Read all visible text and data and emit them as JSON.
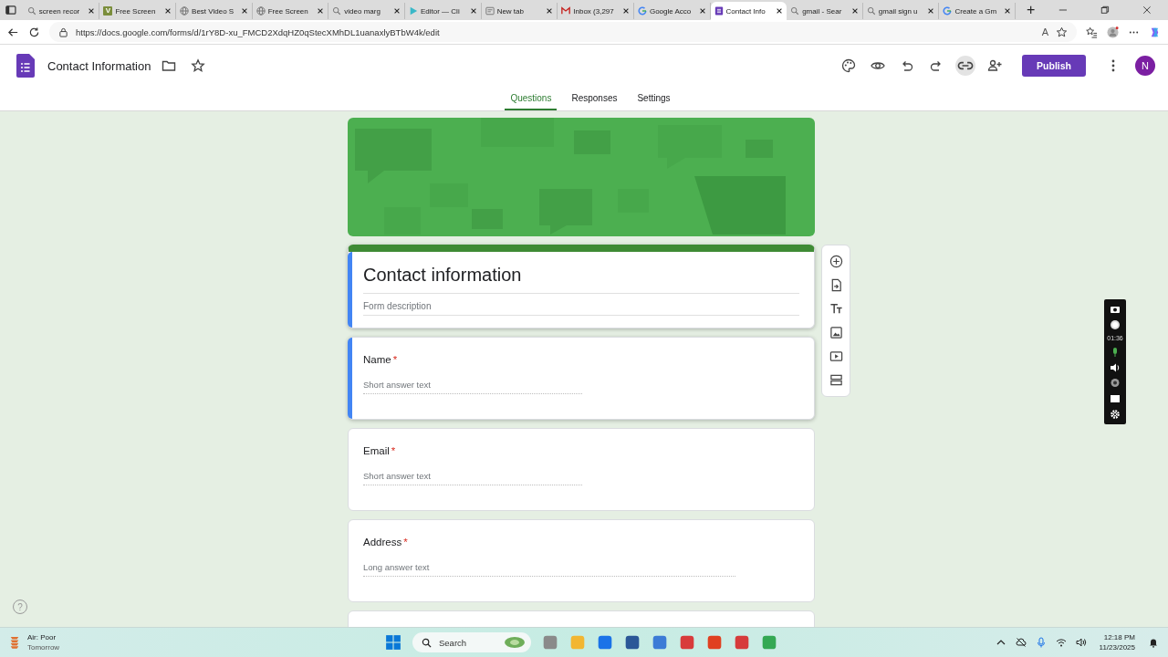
{
  "browser": {
    "tabs": [
      {
        "label": "screen recor",
        "kind": "search",
        "selected": false
      },
      {
        "label": "Free Screen",
        "kind": "letter",
        "selected": false
      },
      {
        "label": "Best Video S",
        "kind": "globe",
        "selected": false
      },
      {
        "label": "Free Screen",
        "kind": "globe",
        "selected": false
      },
      {
        "label": "video marg",
        "kind": "search",
        "selected": false
      },
      {
        "label": "Editor — Cli",
        "kind": "play",
        "selected": false
      },
      {
        "label": "New tab",
        "kind": "page",
        "selected": false
      },
      {
        "label": "Inbox (3,297",
        "kind": "mail",
        "selected": false
      },
      {
        "label": "Google Acco",
        "kind": "google",
        "selected": false
      },
      {
        "label": "Contact Info",
        "kind": "form",
        "selected": true
      },
      {
        "label": "gmail - Sear",
        "kind": "search",
        "selected": false
      },
      {
        "label": "gmail sign u",
        "kind": "search",
        "selected": false
      },
      {
        "label": "Create a Gm",
        "kind": "google",
        "selected": false
      }
    ],
    "favicon_letter": "V",
    "new_tab": "+",
    "url": "https://docs.google.com/forms/d/1rY8D-xu_FMCD2XdqHZ0qStecXMhDL1uanaxlyBTbW4k/edit",
    "read_aloud": "A"
  },
  "form_header": {
    "title": "Contact Information",
    "publish": "Publish",
    "avatar": "N",
    "tabs": [
      {
        "label": "Questions",
        "selected": true
      },
      {
        "label": "Responses",
        "selected": false
      },
      {
        "label": "Settings",
        "selected": false
      }
    ]
  },
  "form": {
    "title": "Contact information",
    "description_placeholder": "Form description",
    "title_focused": true,
    "questions": [
      {
        "title": "Name",
        "required": true,
        "kind": "short",
        "answer_placeholder": "Short answer text",
        "focused": true
      },
      {
        "title": "Email",
        "required": true,
        "kind": "short",
        "answer_placeholder": "Short answer text",
        "focused": false
      },
      {
        "title": "Address",
        "required": true,
        "kind": "long",
        "answer_placeholder": "Long answer text",
        "focused": false
      }
    ],
    "required_mark": "*"
  },
  "help": "?",
  "recorder": {
    "timer": "01:36"
  },
  "taskbar": {
    "weather_title": "Air: Poor",
    "weather_subtitle": "Tomorrow",
    "search_placeholder": "Search",
    "time": "12:18 PM",
    "date": "11/23/2025"
  }
}
